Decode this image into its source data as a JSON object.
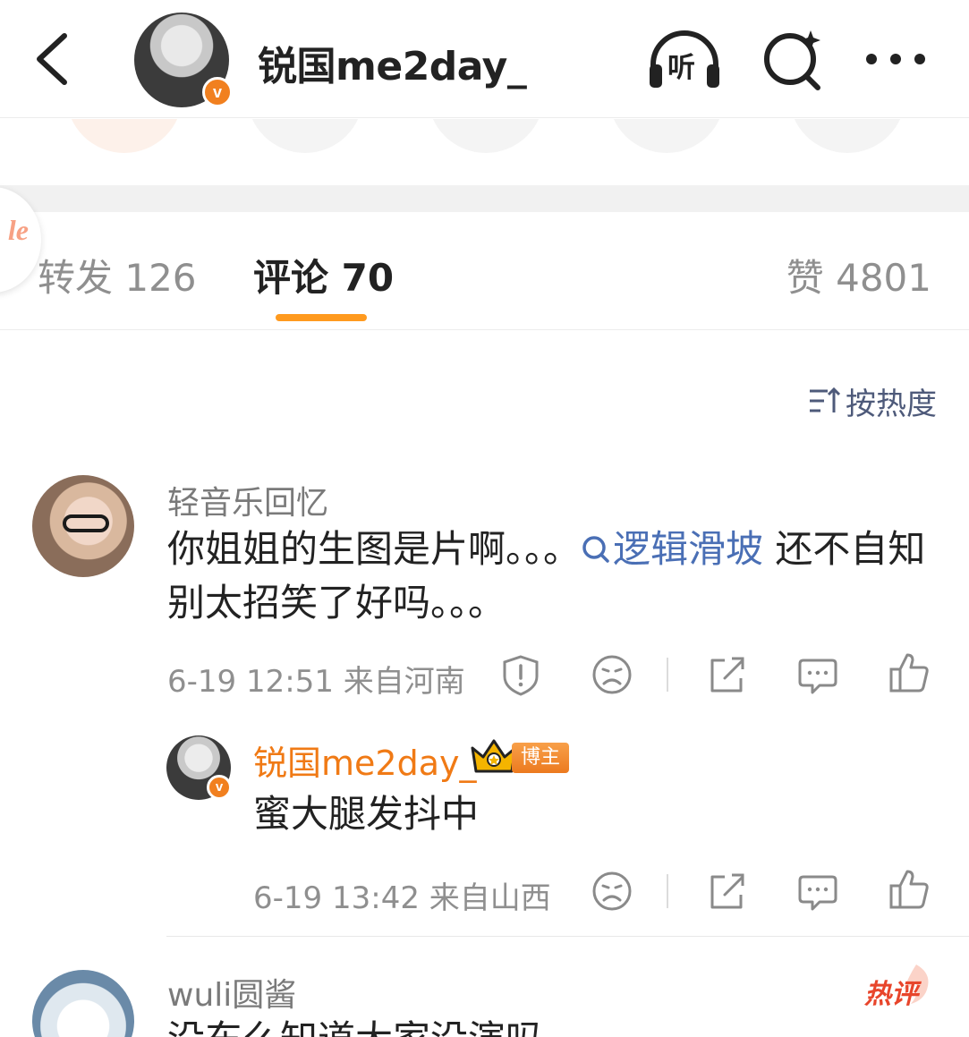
{
  "header": {
    "title": "锐国me2day_",
    "listen_label": "听",
    "verified_badge": "v"
  },
  "floating_logo_text": "le",
  "tabs": {
    "reposts": "转发 126",
    "comments": "评论 70",
    "likes": "赞 4801"
  },
  "sort": {
    "label": "按热度"
  },
  "comments": [
    {
      "username": "轻音乐回忆",
      "text_before": "你姐姐的生图是片啊。。。",
      "topic": "逻辑滑坡",
      "text_after": " 还不自知别太招笑了好吗。。。",
      "meta": "6-19 12:51  来自河南",
      "reply": {
        "username": "锐国me2day_",
        "owner_tag": "博主",
        "text": "蜜大腿发抖中",
        "meta": "6-19 13:42  来自山西",
        "verified_badge": "v"
      }
    },
    {
      "username": "wuli圆酱",
      "hot_tag": "热评",
      "text": "没东么知道大家没演吗"
    }
  ],
  "colors": {
    "accent": "#ff9a1f",
    "link": "#4a6fb5",
    "blogger_name": "#f07a15"
  },
  "icons": [
    "back-arrow-icon",
    "headphone-icon",
    "search-sparkle-icon",
    "more-dots-icon",
    "sort-icon",
    "report-icon",
    "dislike-face-icon",
    "share-icon",
    "comment-icon",
    "like-icon",
    "crown-icon"
  ]
}
